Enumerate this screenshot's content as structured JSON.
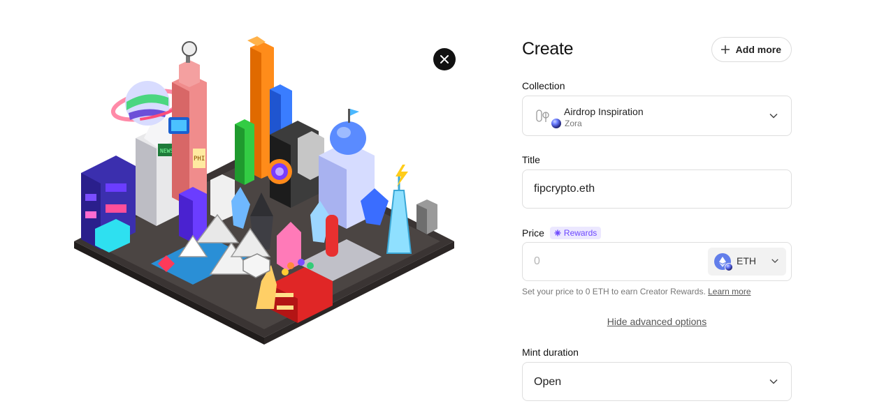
{
  "artwork": {
    "kind": "isometric pixel-art city"
  },
  "close": {
    "icon": "close-icon"
  },
  "form": {
    "title": "Create",
    "add_more_label": "Add more",
    "collection": {
      "label": "Collection",
      "name": "Airdrop Inspiration",
      "network": "Zora",
      "logo_text": "φ"
    },
    "title_field": {
      "label": "Title",
      "value": "fipcrypto.eth"
    },
    "price": {
      "label": "Price",
      "badge": "Rewards",
      "placeholder": "0",
      "currency": "ETH",
      "hint": "Set your price to 0 ETH to earn Creator Rewards.",
      "learn_more": "Learn more"
    },
    "advanced_link": "Hide advanced options",
    "mint_duration": {
      "label": "Mint duration",
      "value": "Open"
    }
  },
  "colors": {
    "accent": "#6c47ff",
    "badge_bg": "#ece8ff",
    "eth_blue": "#627eea",
    "border": "#dedede",
    "text_muted": "#777777"
  }
}
